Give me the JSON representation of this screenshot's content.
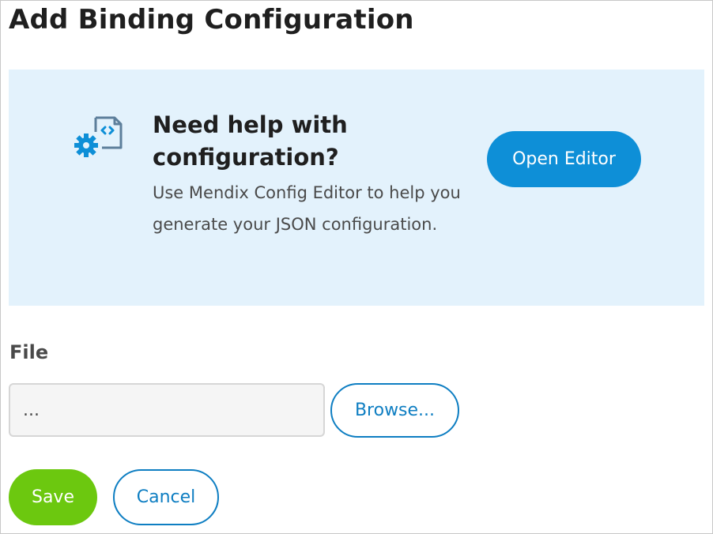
{
  "dialog": {
    "title": "Add Binding Configuration"
  },
  "help_panel": {
    "icon": "config-editor-icon",
    "heading": "Need help with configuration?",
    "description": "Use Mendix Config Editor to help you generate your JSON configuration.",
    "open_editor_label": "Open Editor"
  },
  "file": {
    "label": "File",
    "value": "...",
    "browse_label": "Browse..."
  },
  "actions": {
    "save_label": "Save",
    "cancel_label": "Cancel"
  },
  "colors": {
    "panel_bg": "#e3f2fc",
    "primary": "#0e8fd7",
    "link": "#0e7ec2",
    "save": "#6cc80f"
  }
}
